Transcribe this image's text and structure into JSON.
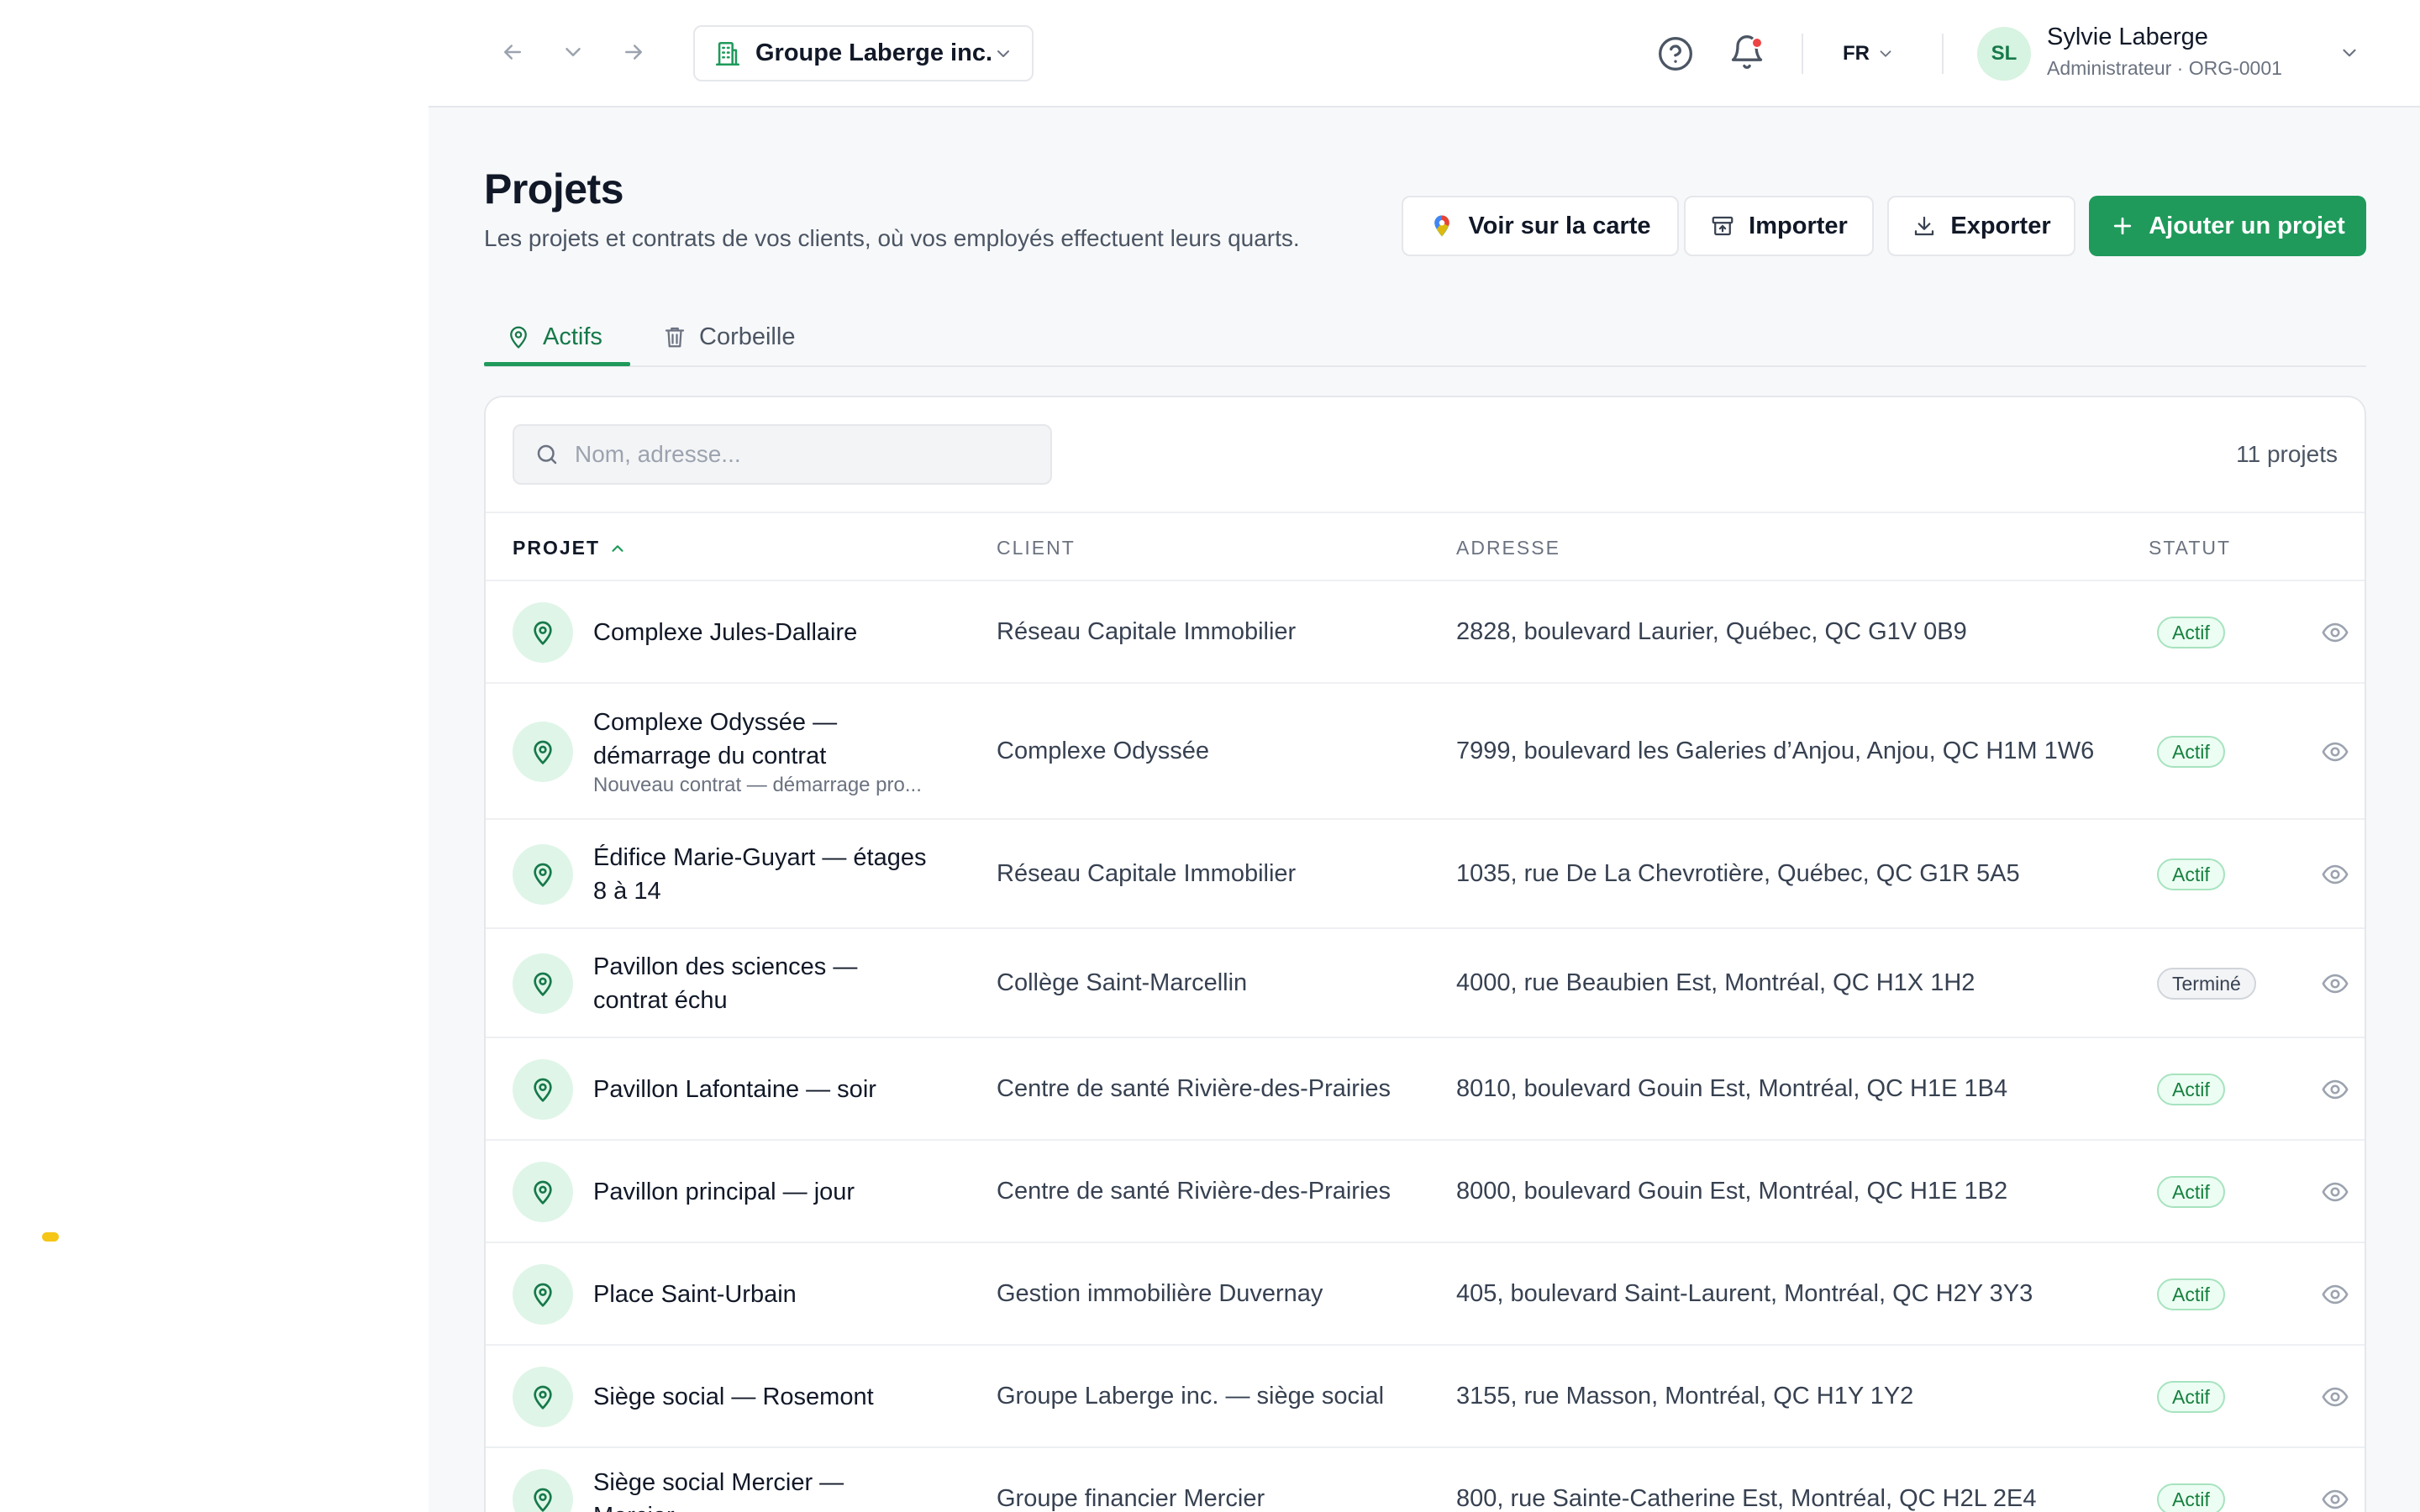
{
  "topbar": {
    "org_name": "Groupe Laberge inc.",
    "lang": "FR",
    "avatar_initials": "SL",
    "user_name": "Sylvie Laberge",
    "user_role": "Administrateur · ORG-0001"
  },
  "header": {
    "title": "Projets",
    "subtitle": "Les projets et contrats de vos clients, où vos employés effectuent leurs quarts.",
    "btn_map": "Voir sur la carte",
    "btn_import": "Importer",
    "btn_export": "Exporter",
    "btn_add": "Ajouter un projet"
  },
  "tabs": [
    {
      "label": "Actifs"
    },
    {
      "label": "Corbeille"
    }
  ],
  "search": {
    "placeholder": "Nom, adresse..."
  },
  "count": "11 projets",
  "columns": [
    "PROJET",
    "CLIENT",
    "ADRESSE",
    "STATUT"
  ],
  "rows": [
    {
      "name": "Complexe Jules-Dallaire",
      "name2": "",
      "sub": "",
      "client": "Réseau Capitale Immobilier",
      "address": "2828, boulevard Laurier, Québec, QC G1V 0B9",
      "status": "Actif"
    },
    {
      "name": "Complexe Odyssée —",
      "name2": "démarrage du contrat",
      "sub": "Nouveau contrat — démarrage pro...",
      "client": "Complexe Odyssée",
      "address": "7999, boulevard les Galeries d’Anjou, Anjou, QC H1M 1W6",
      "status": "Actif"
    },
    {
      "name": "Édifice Marie-Guyart — étages",
      "name2": "8 à 14",
      "sub": "",
      "client": "Réseau Capitale Immobilier",
      "address": "1035, rue De La Chevrotière, Québec, QC G1R 5A5",
      "status": "Actif"
    },
    {
      "name": "Pavillon des sciences —",
      "name2": "contrat échu",
      "sub": "",
      "client": "Collège Saint-Marcellin",
      "address": "4000, rue Beaubien Est, Montréal, QC H1X 1H2",
      "status": "Terminé"
    },
    {
      "name": "Pavillon Lafontaine — soir",
      "name2": "",
      "sub": "",
      "client": "Centre de santé Rivière-des-Prairies",
      "address": "8010, boulevard Gouin Est, Montréal, QC H1E 1B4",
      "status": "Actif"
    },
    {
      "name": "Pavillon principal — jour",
      "name2": "",
      "sub": "",
      "client": "Centre de santé Rivière-des-Prairies",
      "address": "8000, boulevard Gouin Est, Montréal, QC H1E 1B2",
      "status": "Actif"
    },
    {
      "name": "Place Saint-Urbain",
      "name2": "",
      "sub": "",
      "client": "Gestion immobilière Duvernay",
      "address": "405, boulevard Saint-Laurent, Montréal, QC H2Y 3Y3",
      "status": "Actif"
    },
    {
      "name": "Siège social — Rosemont",
      "name2": "",
      "sub": "",
      "client": "Groupe Laberge inc. — siège social",
      "address": "3155, rue Masson, Montréal, QC H1Y 1Y2",
      "status": "Actif"
    },
    {
      "name": "Siège social Mercier —",
      "name2": "Mercier",
      "sub": "",
      "client": "Groupe financier Mercier",
      "address": "800, rue Sainte-Catherine Est, Montréal, QC H2L 2E4",
      "status": "Actif"
    }
  ],
  "colors": {
    "accent": "#1f9a5b",
    "accent_dark": "#16794a",
    "notification": "#ef4444"
  }
}
